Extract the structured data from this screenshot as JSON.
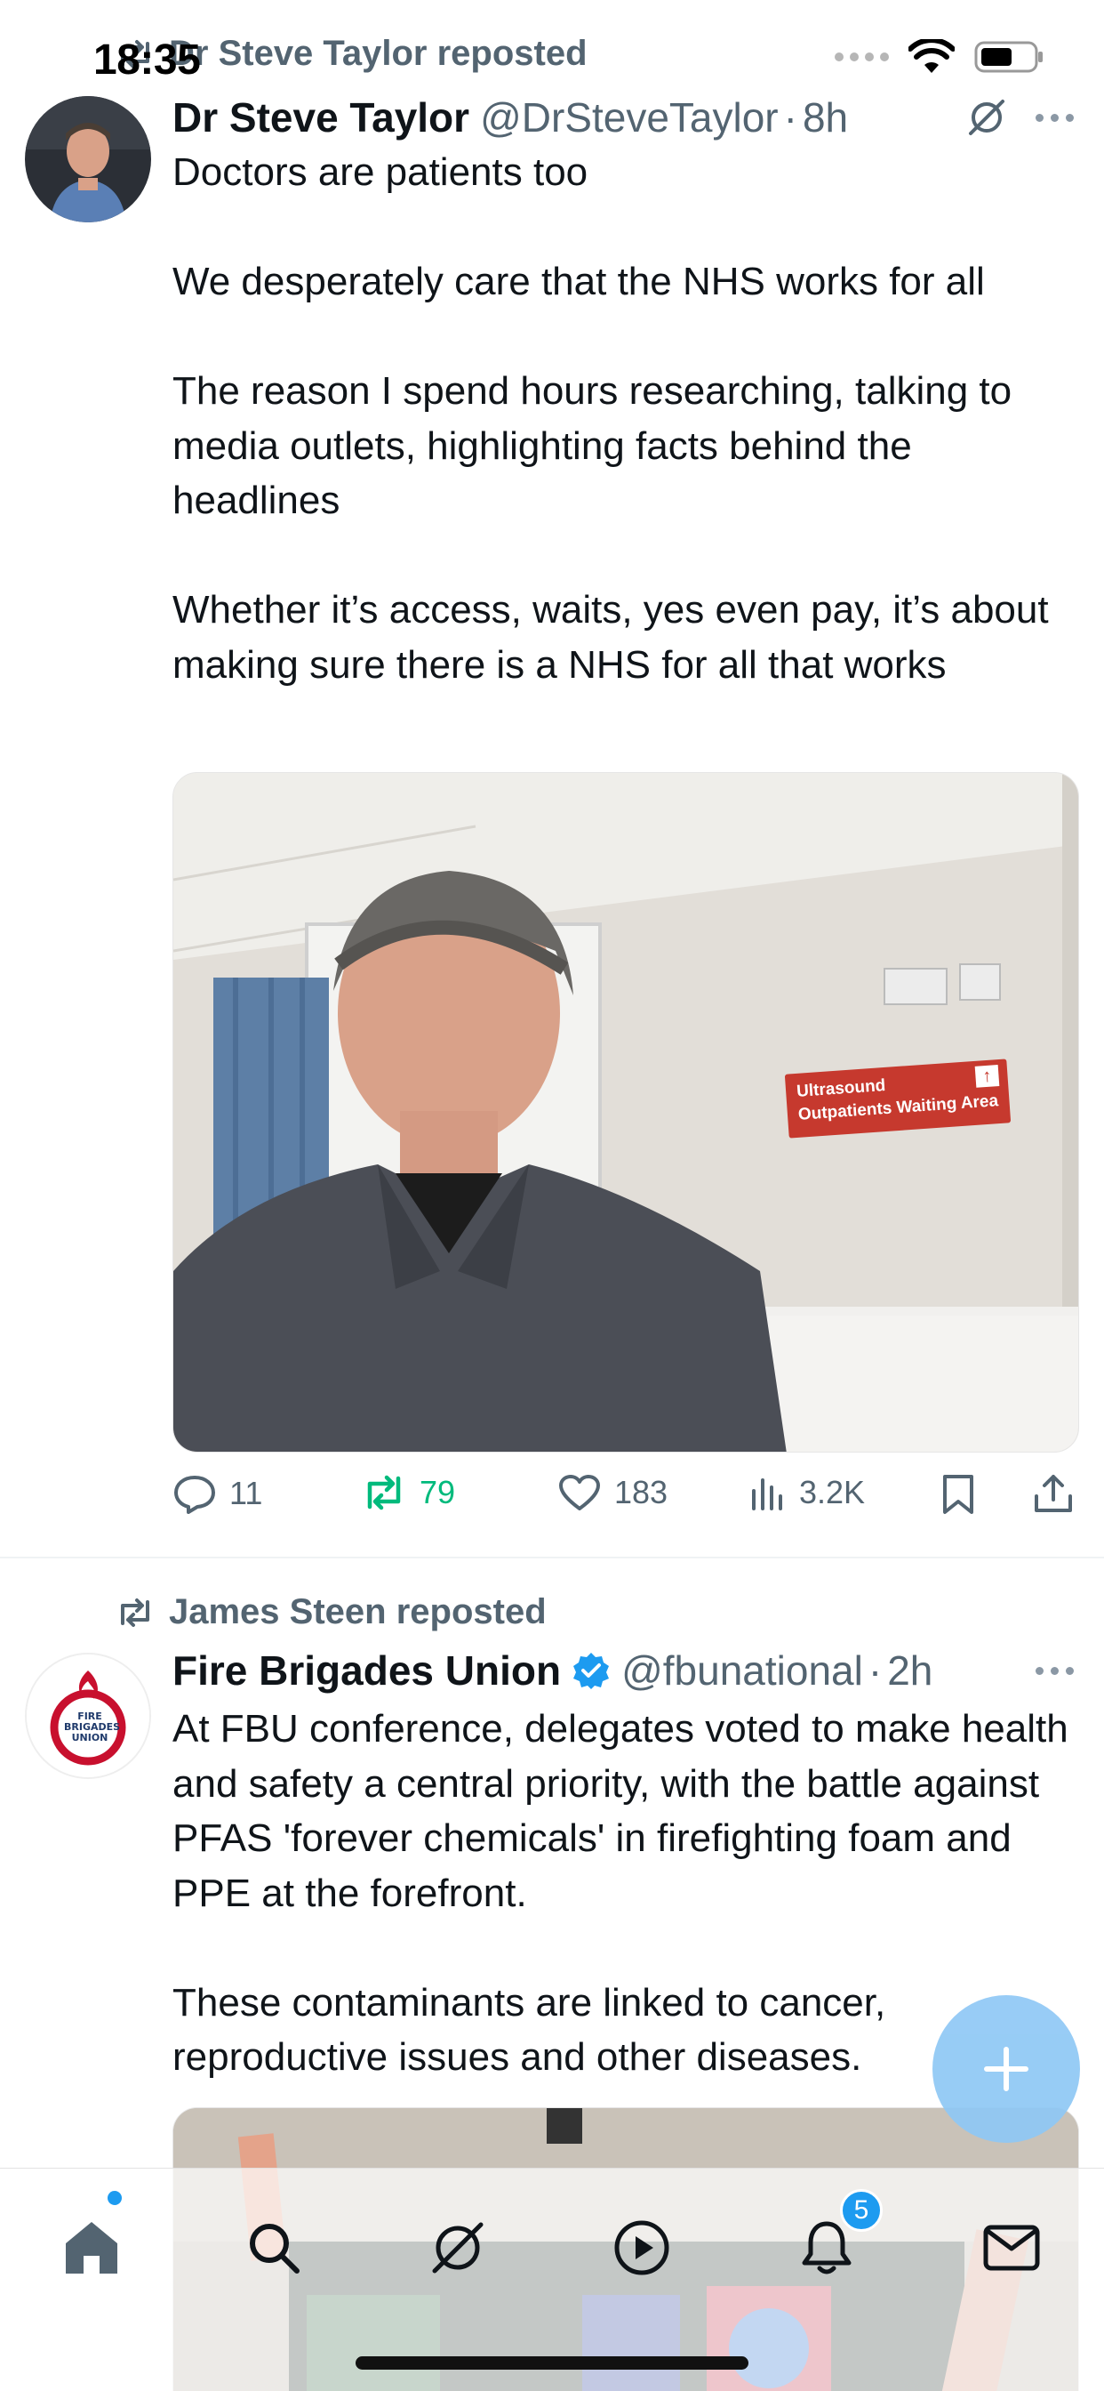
{
  "status_bar": {
    "time": "18:35"
  },
  "tweets": [
    {
      "repost_label": "Dr Steve Taylor reposted",
      "author_name": "Dr Steve Taylor",
      "handle": "@DrSteveTaylor",
      "time": "8h",
      "paragraphs": [
        "Doctors are patients too",
        "We desperately care that the NHS works for all",
        "The reason I spend hours researching, talking to media outlets, highlighting facts behind the headlines",
        "Whether it’s access, waits, yes even pay, it’s about making sure there is a NHS for all that works"
      ],
      "image_sign_line1": "Ultrasound",
      "image_sign_line2": "Outpatients Waiting Area",
      "actions": {
        "replies": "11",
        "reposts": "79",
        "likes": "183",
        "views": "3.2K"
      }
    },
    {
      "repost_label": "James Steen reposted",
      "author_name": "Fire Brigades Union",
      "handle": "@fbunational",
      "time": "2h",
      "avatar_logo_text": "FIRE BRIGADES UNION",
      "paragraphs": [
        "At FBU conference, delegates voted to make health and safety a central priority, with the battle against PFAS 'forever chemicals' in firefighting foam and PPE at the forefront.",
        "These contaminants are linked to cancer, reproductive issues and other diseases."
      ]
    }
  ],
  "tab_bar": {
    "notifications_badge": "5",
    "icons": [
      "home-icon",
      "search-icon",
      "grok-icon",
      "video-play-icon",
      "notifications-bell-icon",
      "messages-envelope-icon"
    ]
  },
  "colors": {
    "accent": "#1d9bf0",
    "repost_green": "#00ba7c",
    "muted": "#536471",
    "fab": "#8fc8f5"
  }
}
